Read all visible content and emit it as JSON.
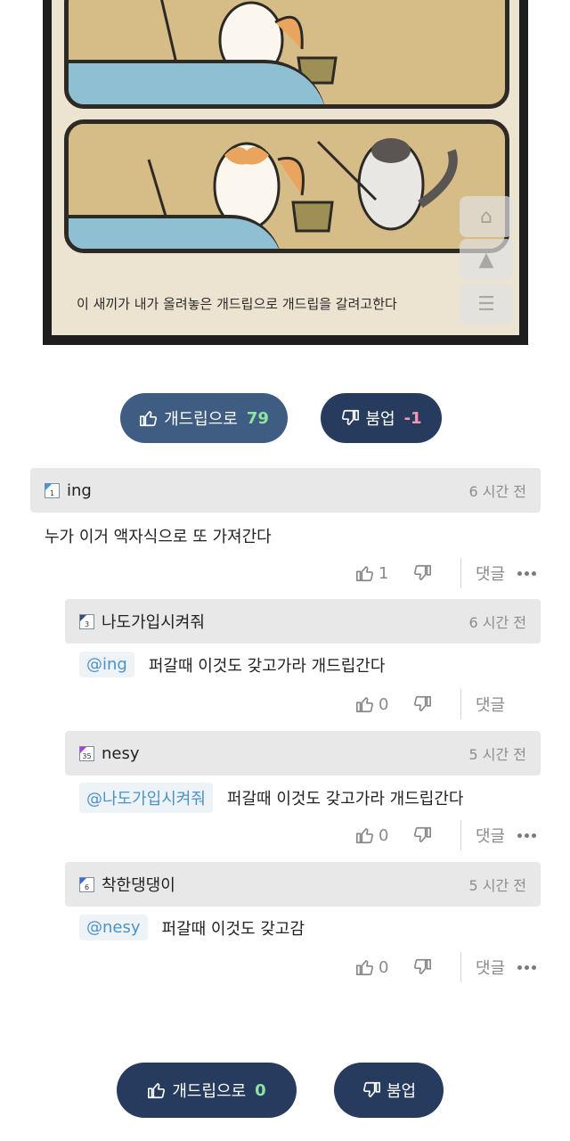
{
  "comic": {
    "caption": "이 새끼가 내가 올려놓은 개드립으로 개드립을 갈려고한다"
  },
  "post_vote": {
    "up_label": "개드립으로",
    "up_count": "79",
    "down_label": "붐업",
    "down_count": "-1"
  },
  "comments": [
    {
      "level": "1",
      "nick": "ing",
      "time": "6 시간 전",
      "mention": "",
      "text": "누가 이거 액자식으로 또 가져간다",
      "likes": "1",
      "reply": "댓글",
      "level_color": "#3a9ad9"
    },
    {
      "level": "3",
      "nick": "나도가입시켜줘",
      "time": "6 시간 전",
      "mention": "@ing",
      "text": "퍼갈때 이것도 갖고가라 개드립간다",
      "likes": "0",
      "reply": "댓글",
      "level_color": "#2f4f7a"
    },
    {
      "level": "35",
      "nick": "nesy",
      "time": "5 시간 전",
      "mention": "@나도가입시켜줘",
      "text": "퍼갈때 이것도 갖고가라 개드립간다",
      "likes": "0",
      "reply": "댓글",
      "level_color": "#b43ad9"
    },
    {
      "level": "6",
      "nick": "착한댕댕이",
      "time": "5 시간 전",
      "mention": "@nesy",
      "text": "퍼갈때 이것도 갖고감",
      "likes": "0",
      "reply": "댓글",
      "level_color": "#3a6ad9"
    }
  ],
  "bottom_vote": {
    "up_label": "개드립으로",
    "up_count": "0",
    "down_label": "붐업"
  },
  "icons": {
    "thumb_up": "thumbs-up-icon",
    "thumb_down": "thumbs-down-icon",
    "more": "more-dots-icon"
  }
}
